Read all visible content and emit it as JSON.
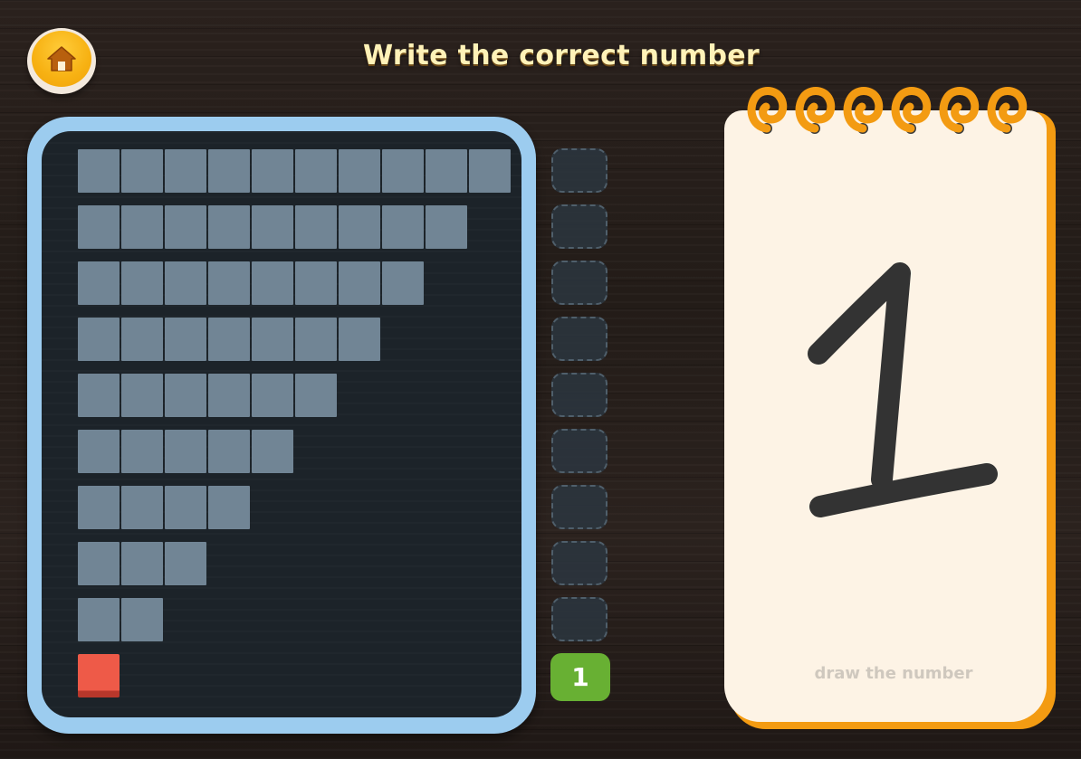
{
  "header": {
    "title": "Write the correct number",
    "home_icon": "home-icon"
  },
  "board": {
    "rows": [
      10,
      9,
      8,
      7,
      6,
      5,
      4,
      3,
      2,
      1
    ],
    "highlighted_row_index": 9,
    "block_color": "#718595",
    "highlight_color": "#ee5a48"
  },
  "slots": {
    "empty_count": 9,
    "answer": "1",
    "answer_color": "#68b033"
  },
  "notepad": {
    "written_number": "1",
    "hint": "draw the number",
    "ring_count": 6,
    "accent": "#f39b12"
  }
}
